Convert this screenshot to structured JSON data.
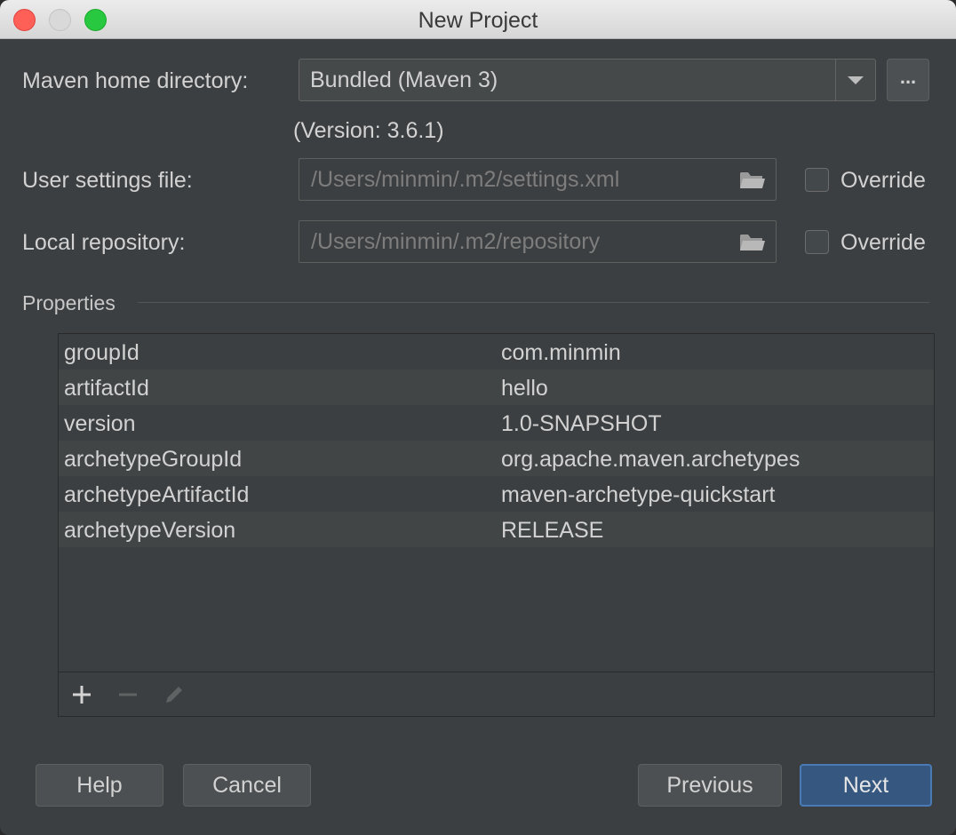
{
  "window": {
    "title": "New Project"
  },
  "maven_home": {
    "label": "Maven home directory:",
    "value": "Bundled (Maven 3)",
    "browse_label": "...",
    "version": "(Version: 3.6.1)"
  },
  "user_settings": {
    "label": "User settings file:",
    "path": "/Users/minmin/.m2/settings.xml",
    "override_label": "Override"
  },
  "local_repo": {
    "label": "Local repository:",
    "path": "/Users/minmin/.m2/repository",
    "override_label": "Override"
  },
  "properties": {
    "title": "Properties",
    "rows": [
      {
        "key": "groupId",
        "value": "com.minmin"
      },
      {
        "key": "artifactId",
        "value": "hello"
      },
      {
        "key": "version",
        "value": "1.0-SNAPSHOT"
      },
      {
        "key": "archetypeGroupId",
        "value": "org.apache.maven.archetypes"
      },
      {
        "key": "archetypeArtifactId",
        "value": "maven-archetype-quickstart"
      },
      {
        "key": "archetypeVersion",
        "value": "RELEASE"
      }
    ],
    "tools": [
      "plus-icon",
      "minus-icon",
      "pencil-icon"
    ]
  },
  "buttons": {
    "help": "Help",
    "cancel": "Cancel",
    "previous": "Previous",
    "next": "Next"
  },
  "colors": {
    "background": "#3c3f41",
    "accent": "#365880",
    "text": "#d2d2d2"
  }
}
